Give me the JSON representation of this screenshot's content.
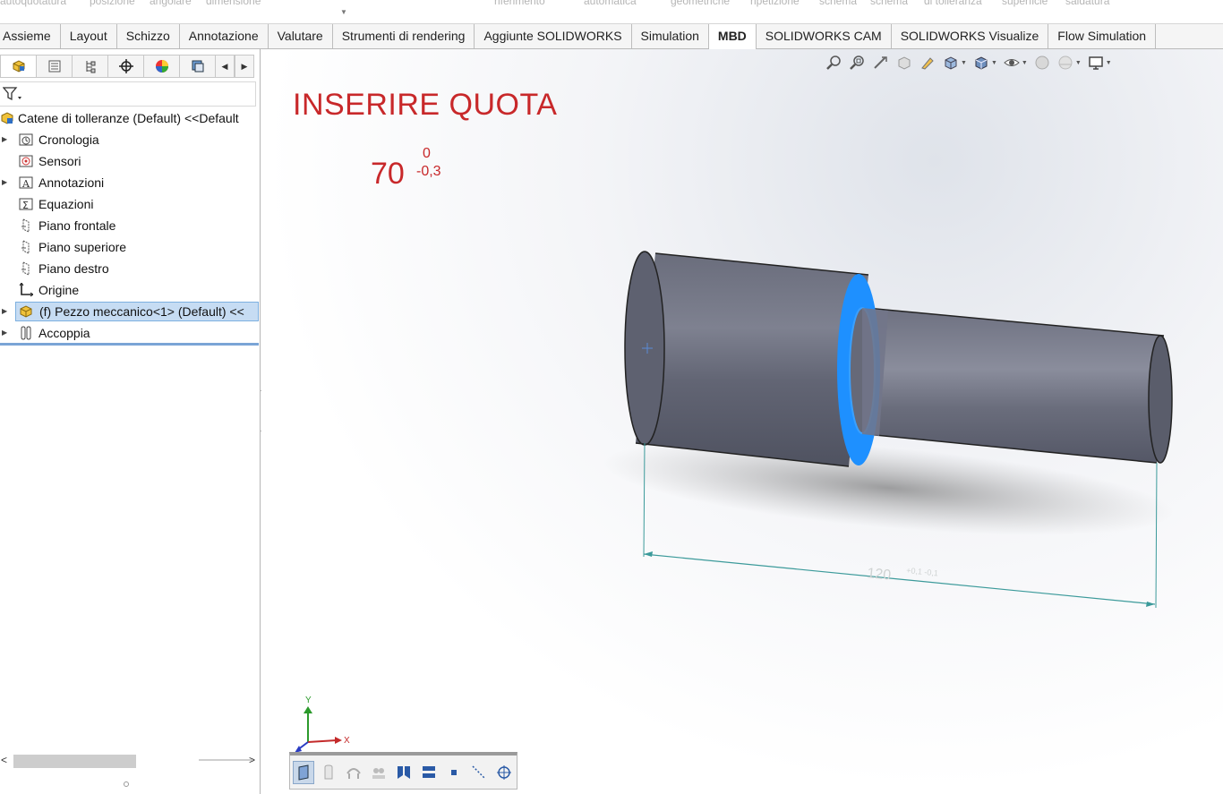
{
  "ribbon_top": {
    "labels": [
      "autoquotatura",
      "posizione",
      "angolare",
      "dimensione",
      "riferimento",
      "automatica",
      "geometriche",
      "ripetizione",
      "schema",
      "schema",
      "di tolleranza",
      "superficie",
      "saldatura"
    ]
  },
  "tabs": [
    {
      "label": "Assieme",
      "active": false
    },
    {
      "label": "Layout",
      "active": false
    },
    {
      "label": "Schizzo",
      "active": false
    },
    {
      "label": "Annotazione",
      "active": false
    },
    {
      "label": "Valutare",
      "active": false
    },
    {
      "label": "Strumenti di rendering",
      "active": false
    },
    {
      "label": "Aggiunte SOLIDWORKS",
      "active": false
    },
    {
      "label": "Simulation",
      "active": false
    },
    {
      "label": "MBD",
      "active": true
    },
    {
      "label": "SOLIDWORKS CAM",
      "active": false
    },
    {
      "label": "SOLIDWORKS Visualize",
      "active": false
    },
    {
      "label": "Flow Simulation",
      "active": false
    }
  ],
  "feature_tree": {
    "root": "Catene di tolleranze (Default) <<Default",
    "items": [
      {
        "label": "Cronologia",
        "icon": "history-icon",
        "expandable": true
      },
      {
        "label": "Sensori",
        "icon": "sensor-icon",
        "expandable": false
      },
      {
        "label": "Annotazioni",
        "icon": "annotations-icon",
        "expandable": true
      },
      {
        "label": "Equazioni",
        "icon": "equations-icon",
        "expandable": false
      },
      {
        "label": "Piano frontale",
        "icon": "plane-icon",
        "expandable": false
      },
      {
        "label": "Piano superiore",
        "icon": "plane-icon",
        "expandable": false
      },
      {
        "label": "Piano destro",
        "icon": "plane-icon",
        "expandable": false
      },
      {
        "label": "Origine",
        "icon": "origin-icon",
        "expandable": false
      },
      {
        "label": "(f) Pezzo meccanico<1> (Default) <<",
        "icon": "part-icon",
        "expandable": true,
        "selected": true
      },
      {
        "label": "Accoppia",
        "icon": "mates-icon",
        "expandable": true
      }
    ]
  },
  "viewport": {
    "note_title": "INSERIRE QUOTA",
    "dimension": {
      "nominal": "70",
      "upper": "0",
      "lower": "-0,3"
    },
    "model_dimension": {
      "nominal": "120",
      "tolerance": "+0,1 -0,1"
    },
    "triad": {
      "x": "X",
      "y": "Y"
    }
  },
  "colors": {
    "accent_red": "#c8282a",
    "selection_blue": "#1e90ff",
    "model_gray": "#5e6170",
    "dimension_teal": "#3b9a9a"
  }
}
